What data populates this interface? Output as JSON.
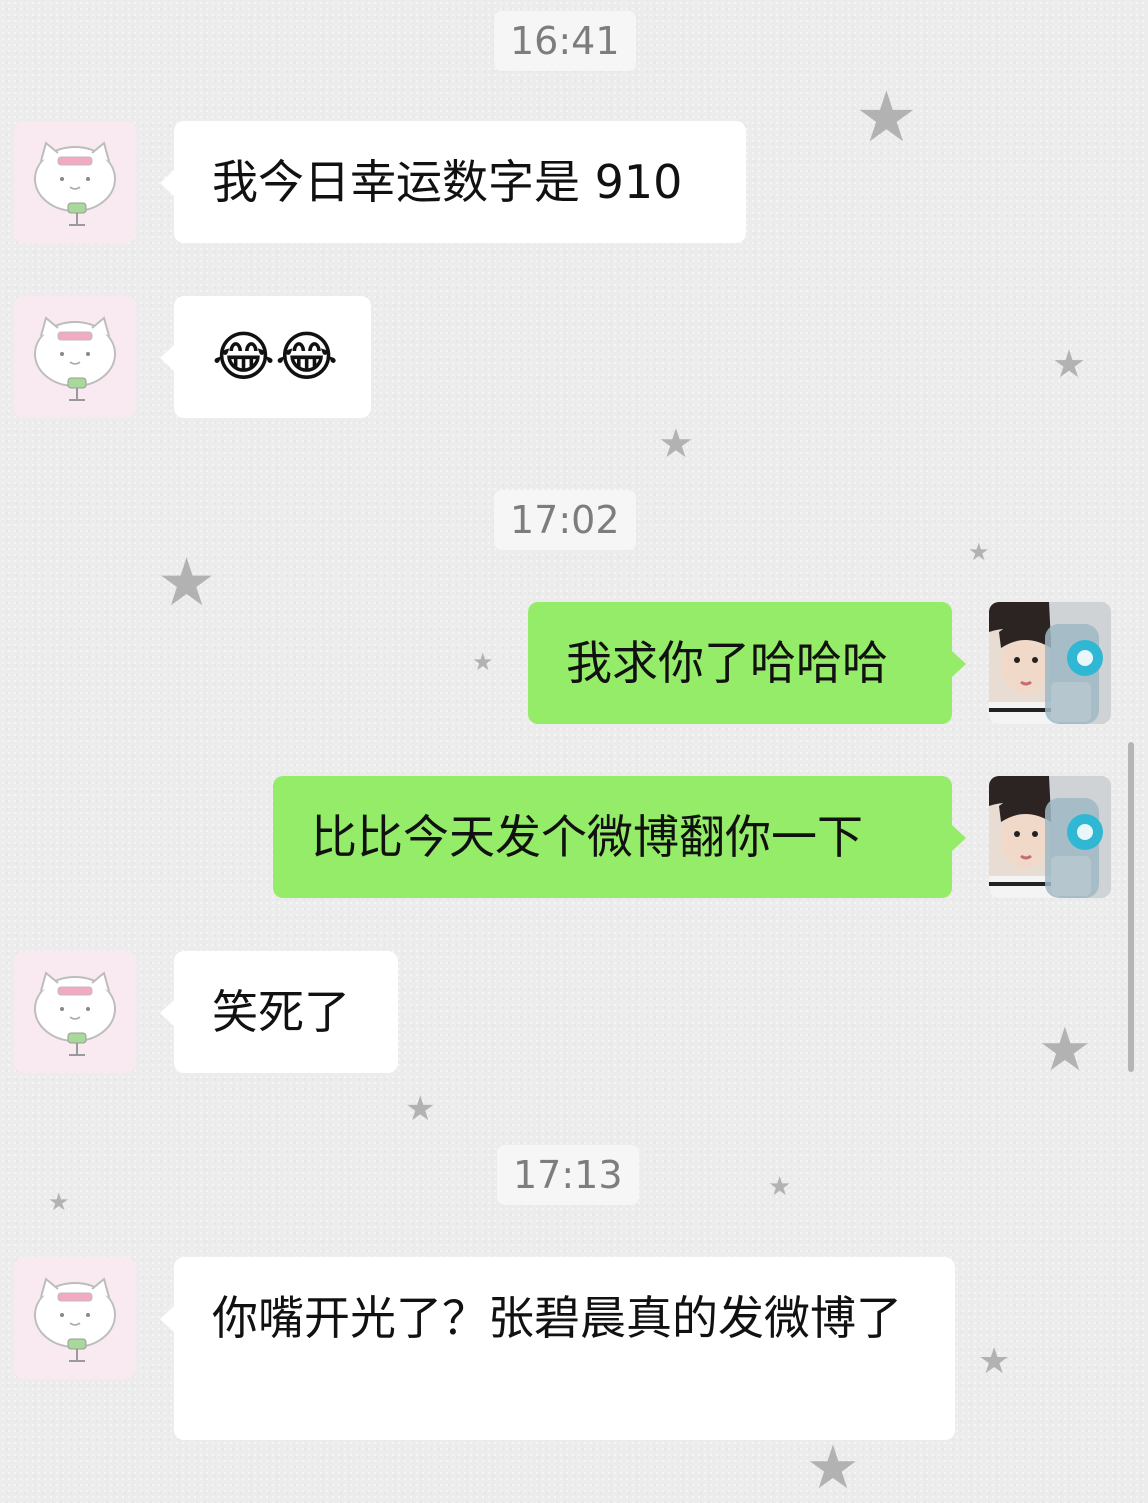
{
  "timestamps": [
    "16:41",
    "17:02",
    "17:13"
  ],
  "messages": [
    {
      "from": "other",
      "text": "我今日幸运数字是 910"
    },
    {
      "from": "other",
      "text": "😂😂"
    },
    {
      "from": "self",
      "text": "我求你了哈哈哈"
    },
    {
      "from": "self",
      "text": "比比今天发个微博翻你一下"
    },
    {
      "from": "other",
      "text": "笑死了"
    },
    {
      "from": "other",
      "text": "你嘴开光了？张碧晨真的发微博了"
    }
  ],
  "icons": {
    "other_avatar": "cat-avatar-icon",
    "self_avatar": "profile-photo",
    "background": "star-icon"
  },
  "colors": {
    "self_bubble": "#95ec69",
    "other_bubble": "#ffffff",
    "background": "#ececec",
    "timestamp_bg": "#f6f6f6"
  }
}
